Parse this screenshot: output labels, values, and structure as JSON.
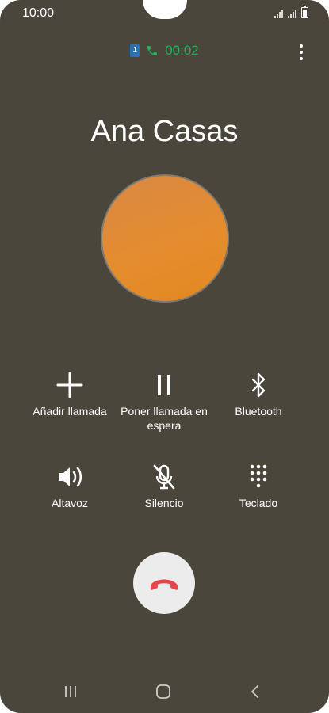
{
  "status_bar": {
    "time": "10:00"
  },
  "call": {
    "sim_slot": "1",
    "timer": "00:02",
    "contact_name": "Ana Casas"
  },
  "actions": [
    {
      "label": "Añadir llamada",
      "icon": "add-icon"
    },
    {
      "label": "Poner llamada en espera",
      "icon": "pause-icon"
    },
    {
      "label": "Bluetooth",
      "icon": "bluetooth-icon"
    },
    {
      "label": "Altavoz",
      "icon": "speaker-icon"
    },
    {
      "label": "Silencio",
      "icon": "mic-off-icon"
    },
    {
      "label": "Teclado",
      "icon": "keypad-icon"
    }
  ],
  "end_call": {
    "icon": "end-call-icon"
  },
  "nav_bar": {
    "items": [
      "recents-icon",
      "home-icon",
      "back-icon"
    ]
  },
  "colors": {
    "background": "#4b463b",
    "accent_green": "#1fb25a",
    "end_call_red": "#e8454a",
    "avatar_orange": "#e58c2d"
  }
}
